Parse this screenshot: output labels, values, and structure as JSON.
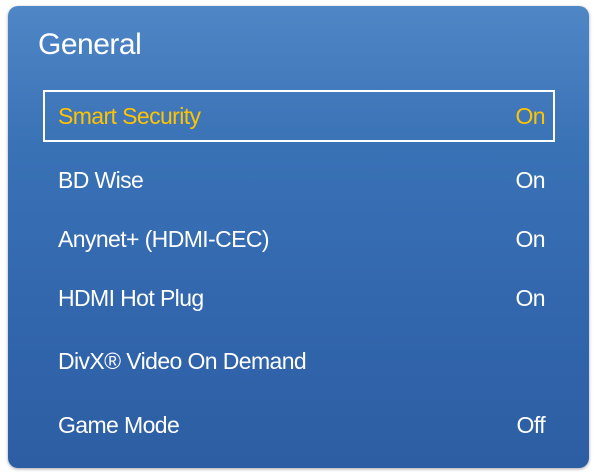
{
  "menu": {
    "title": "General",
    "items": [
      {
        "label": "Smart Security",
        "value": "On",
        "selected": true
      },
      {
        "label": "BD Wise",
        "value": "On",
        "selected": false
      },
      {
        "label": "Anynet+ (HDMI-CEC)",
        "value": "On",
        "selected": false
      },
      {
        "label": "HDMI Hot Plug",
        "value": "On",
        "selected": false
      },
      {
        "label": "DivX® Video On Demand",
        "value": "",
        "selected": false
      },
      {
        "label": "Game Mode",
        "value": "Off",
        "selected": false
      }
    ]
  },
  "colors": {
    "panel_bg": "#3a72b6",
    "selected_text": "#ffc400",
    "text": "#ffffff"
  }
}
